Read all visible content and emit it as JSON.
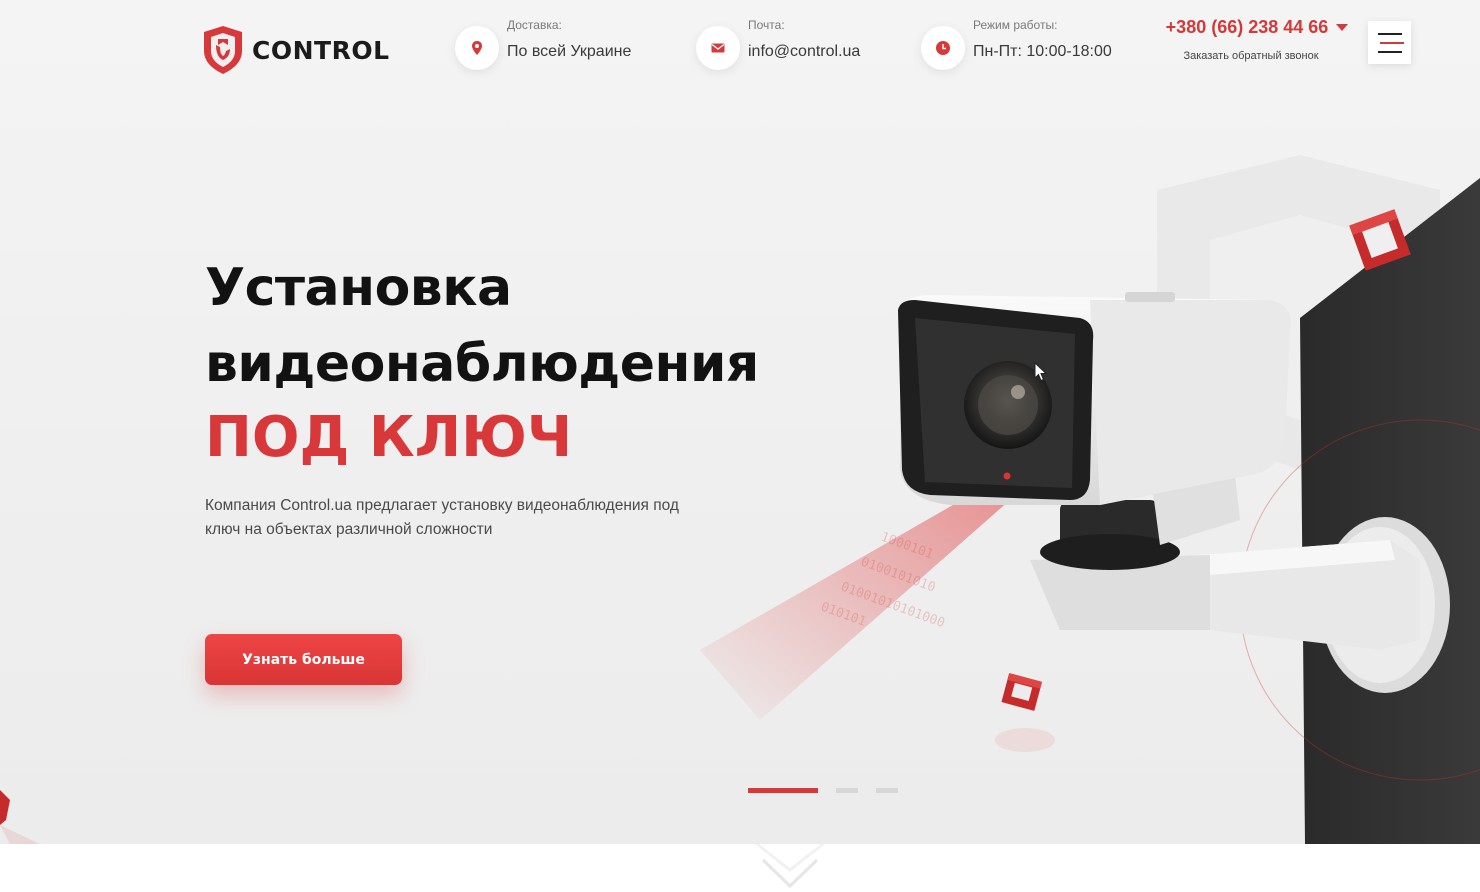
{
  "header": {
    "logo_text": "CONTROL",
    "delivery": {
      "label": "Доставка:",
      "value": "По всей Украине",
      "icon": "location-pin-icon"
    },
    "mail": {
      "label": "Почта:",
      "value": "info@control.ua",
      "icon": "envelope-icon"
    },
    "hours": {
      "label": "Режим работы:",
      "value": "Пн-Пт: 10:00-18:00",
      "icon": "clock-icon"
    },
    "phone": "+380 (66) 238 44 66",
    "callback": "Заказать обратный звонок",
    "menu_icon": "hamburger-menu-icon"
  },
  "hero": {
    "title_line1": "Установка",
    "title_line2": "видеонаблюдения",
    "title_line3": "ПОД КЛЮЧ",
    "description": "Компания Control.ua предлагает установку видеонаблюдения под ключ на объектах различной сложности",
    "cta_label": "Узнать больше",
    "slides": 3,
    "active_slide": 1
  },
  "colors": {
    "accent": "#d9383a",
    "text_dark": "#121212",
    "background": "#efefef"
  }
}
